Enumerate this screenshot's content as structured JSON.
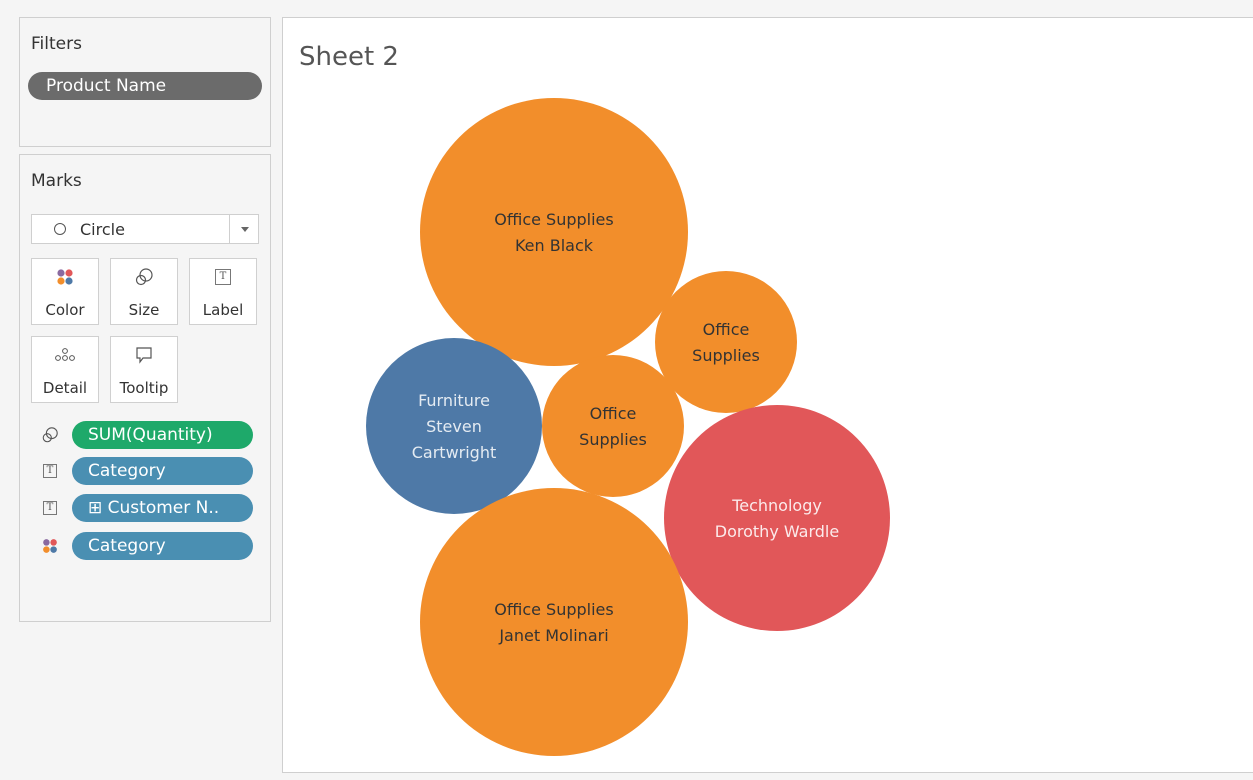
{
  "filters": {
    "title": "Filters",
    "pills": [
      "Product Name"
    ]
  },
  "marks": {
    "title": "Marks",
    "mark_type": "Circle",
    "cards": [
      {
        "label": "Color",
        "icon": "color-dots-icon"
      },
      {
        "label": "Size",
        "icon": "size-icon"
      },
      {
        "label": "Label",
        "icon": "label-t-icon"
      },
      {
        "label": "Detail",
        "icon": "detail-dots-icon"
      },
      {
        "label": "Tooltip",
        "icon": "tooltip-bubble-icon"
      }
    ],
    "shelf": [
      {
        "icon": "size-icon",
        "label": "SUM(Quantity)",
        "color": "#1ea96a"
      },
      {
        "icon": "label-t-icon",
        "label": "Category",
        "color": "#4a8fb2"
      },
      {
        "icon": "label-t-icon",
        "label": "⊞ Customer N..",
        "color": "#4a8fb2"
      },
      {
        "icon": "color-dots-icon",
        "label": "Category",
        "color": "#4a8fb2"
      }
    ]
  },
  "sheet": {
    "title": "Sheet 2"
  },
  "colors": {
    "Office Supplies": "#f28e2b",
    "Furniture": "#4e79a7",
    "Technology": "#e15759"
  },
  "chart_data": {
    "type": "packed-bubble",
    "size_field": "SUM(Quantity)",
    "color_field": "Category",
    "bubbles": [
      {
        "category": "Office Supplies",
        "lines": [
          "Office Supplies",
          "Ken Black"
        ]
      },
      {
        "category": "Office Supplies",
        "lines": [
          "Office",
          "Supplies"
        ]
      },
      {
        "category": "Furniture",
        "lines": [
          "Furniture",
          "Steven",
          "Cartwright"
        ]
      },
      {
        "category": "Office Supplies",
        "lines": [
          "Office",
          "Supplies"
        ]
      },
      {
        "category": "Technology",
        "lines": [
          "Technology",
          "Dorothy Wardle"
        ]
      },
      {
        "category": "Office Supplies",
        "lines": [
          "Office Supplies",
          "Janet Molinari"
        ]
      }
    ]
  }
}
